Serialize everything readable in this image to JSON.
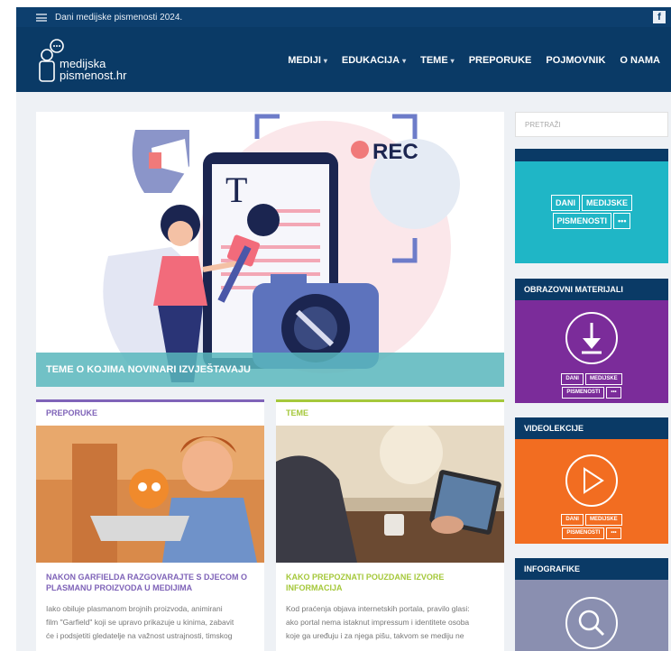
{
  "topbar": {
    "title": "Dani medijske pismenosti 2024.",
    "social_icon": "facebook-icon"
  },
  "header": {
    "logo_line1": "medijska",
    "logo_line2": "pismenost.hr",
    "nav": [
      {
        "label": "MEDIJI",
        "dropdown": true
      },
      {
        "label": "EDUKACIJA",
        "dropdown": true
      },
      {
        "label": "TEME",
        "dropdown": true
      },
      {
        "label": "PREPORUKE",
        "dropdown": false
      },
      {
        "label": "POJMOVNIK",
        "dropdown": false
      },
      {
        "label": "O NAMA",
        "dropdown": false
      }
    ]
  },
  "hero": {
    "caption": "TEME O KOJIMA NOVINARI IZVJEŠTAVAJU",
    "rec": "REC"
  },
  "columns": [
    {
      "label": "PREPORUKE",
      "accent": "#7f63b8",
      "title": "NAKON GARFIELDA RAZGOVARAJTE S DJECOM O PLASMANU PROIZVODA U MEDIJIMA",
      "text_lines": [
        "Iako obiluje plasmanom brojnih proizvoda, animirani",
        "film \"Garfield\" koji se upravo prikazuje u kinima, zabavit",
        "će i podsjetiti gledatelje na važnost ustrajnosti, timskog"
      ]
    },
    {
      "label": "TEME",
      "accent": "#a5c83b",
      "title": "KAKO PREPOZNATI POUZDANE IZVORE INFORMACIJA",
      "text_lines": [
        "Kod praćenja objava internetskih portala, pravilo glasi:",
        "ako portal nema istaknut impressum i identitete osoba",
        "koje ga uređuju i za njega pišu, takvom se mediju ne"
      ]
    }
  ],
  "sidebar": {
    "search_placeholder": "PRETRAŽI",
    "badge": {
      "w1": "DANI",
      "w2": "MEDIJSKE",
      "w3": "PISMENOSTI",
      "dots": "•••"
    },
    "cards": [
      {
        "title": "OBRAZOVNI MATERIJALI",
        "bg": "#7b2c9a",
        "icon": "download-icon"
      },
      {
        "title": "VIDEOLEKCIJE",
        "bg": "#f26d21",
        "icon": "play-icon"
      },
      {
        "title": "INFOGRAFIKE",
        "bg": "#8a8fb0",
        "icon": "search-icon"
      }
    ]
  },
  "colors": {
    "navy": "#0a3a66",
    "teal": "#1fb6c6",
    "caption": "#58b6bc"
  }
}
